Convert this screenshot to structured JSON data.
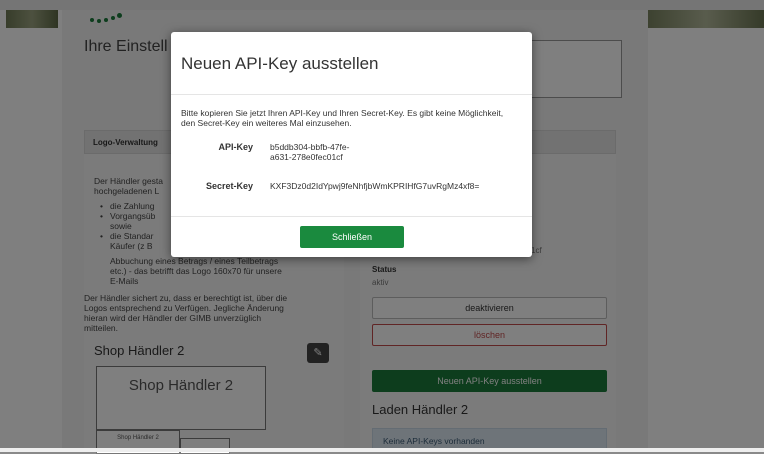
{
  "background": {
    "page_title": "Ihre Einstell",
    "logo_panel_header": "Logo-Verwaltung",
    "logo_text_lines": [
      "Der Händler gesta",
      "hochgeladenen L"
    ],
    "logo_bullets": [
      "die Zahlung",
      "Vorgangsüb",
      "sowie",
      "die Standar",
      "Käufer (z B",
      "Abbuchung eines Betrags / eines Teilbetrags",
      "etc.) - das betrifft das Logo 160x70 für unsere",
      "E-Mails"
    ],
    "logo_paragraph": [
      "Der Händler sichert zu, dass er berechtigt ist, über die",
      "Logos entsprechend zu Verfügen. Jegliche Änderung",
      "hieran wird der Händler der GIMB unverzüglich",
      "mitteilen."
    ],
    "shop_title": "Shop Händler 2",
    "logo_preview_text": "Shop Händler 2",
    "logo_preview_small": "Shop Händler 2",
    "right_partial_text": "1cf",
    "status_label": "Status",
    "status_value": "aktiv",
    "deactivate_label": "deaktivieren",
    "delete_label": "löschen",
    "new_key_label": "Neuen API-Key ausstellen",
    "laden_title": "Laden Händler 2",
    "no_keys_text": "Keine API-Keys vorhanden"
  },
  "modal": {
    "title": "Neuen API-Key ausstellen",
    "description": "Bitte kopieren Sie jetzt Ihren API-Key und Ihren Secret-Key. Es gibt keine Möglichkeit, den Secret-Key ein weiteres Mal einzusehen.",
    "api_key_label": "API-Key",
    "api_key_line1": "b5ddb304-bbfb-47fe-",
    "api_key_line2": "a631-278e0fec01cf",
    "secret_key_label": "Secret-Key",
    "secret_key_value": "KXF3Dz0d2IdYpwj9feNhfjbWmKPRIHfG7uvRgMz4xf8=",
    "close_label": "Schließen"
  },
  "colors": {
    "primary_green": "#1a7a3a",
    "danger_red": "#c04a4a",
    "info_blue": "#dce8f2"
  }
}
